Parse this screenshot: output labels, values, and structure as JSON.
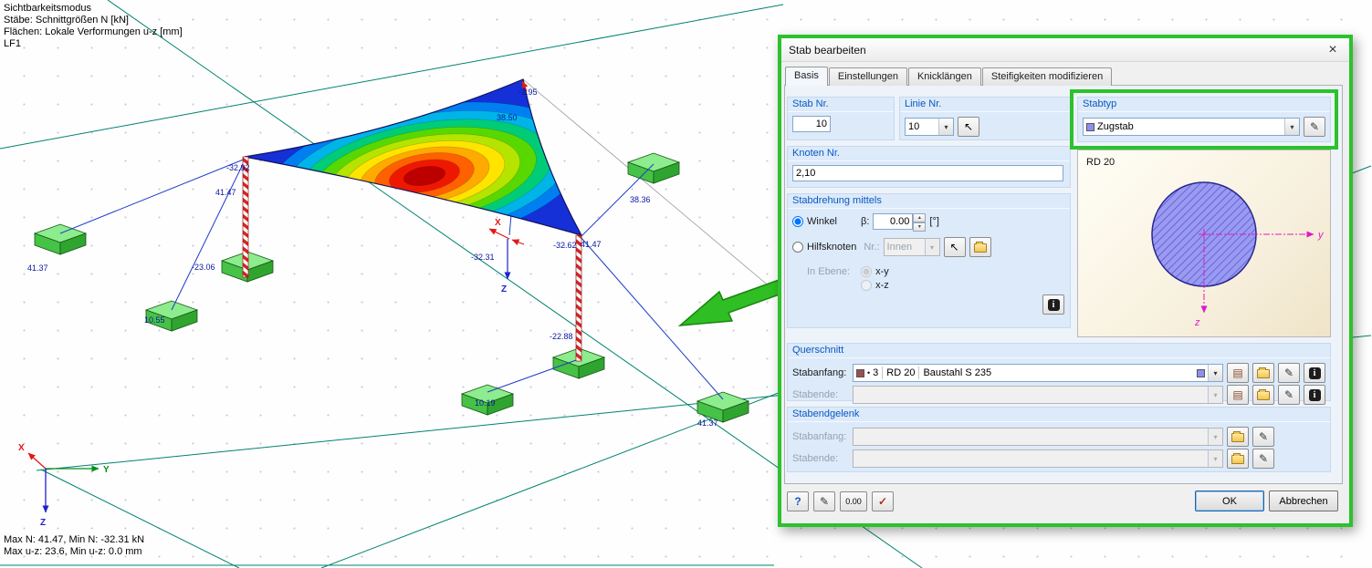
{
  "colors": {
    "highlight_green": "#2bc22b",
    "cable_blue": "#1c3cc8",
    "mast_red": "#d42424",
    "support_block_green": "#46c246",
    "contour_min_blue": "#1630d8",
    "contour_max_red": "#bc0000"
  },
  "icons": {
    "close": "×",
    "dropdown": "▾",
    "spin_up": "▴",
    "spin_down": "▾",
    "pick": "↖",
    "edit": "✎",
    "library": "▤",
    "info": "i",
    "help": "?",
    "check": "✓",
    "bullet": "•"
  },
  "viewport": {
    "info_lines": [
      "Sichtbarkeitsmodus",
      "Stäbe: Schnittgrößen N [kN]",
      "Flächen: Lokale Verformungen u-z [mm]",
      "LF1"
    ],
    "status_lines": [
      "Max N: 41.47, Min N: -32.31 kN",
      "Max u-z: 23.6, Min u-z: 0.0 mm"
    ],
    "axes": {
      "x": "X",
      "y": "Y",
      "z": "Z"
    },
    "force_labels": [
      "-2.95",
      "38.50",
      "-32.92",
      "41.47",
      "38.36",
      "41.37",
      "-23.06",
      "-32.31",
      "-32.62",
      "41.47",
      "10.55",
      "-22.88",
      "10.19",
      "41.37"
    ]
  },
  "dialog": {
    "title": "Stab bearbeiten",
    "tabs": [
      {
        "label": "Basis"
      },
      {
        "label": "Einstellungen"
      },
      {
        "label": "Knicklängen"
      },
      {
        "label": "Steifigkeiten modifizieren"
      }
    ],
    "groups": {
      "stab_nr": {
        "title": "Stab Nr.",
        "value": "10"
      },
      "linie_nr": {
        "title": "Linie Nr.",
        "value": "10"
      },
      "stabtyp": {
        "title": "Stabtyp",
        "value": "Zugstab"
      },
      "knoten_nr": {
        "title": "Knoten Nr.",
        "value": "2,10"
      },
      "stabdrehung": {
        "title": "Stabdrehung mittels",
        "winkel": "Winkel",
        "beta": "β:",
        "beta_value": "0.00",
        "deg_unit": "[°]",
        "hilfsknoten": "Hilfsknoten",
        "nr": "Nr.:",
        "nr_value": "Innen",
        "in_ebene": "In Ebene:",
        "xy": "x-y",
        "xz": "x-z"
      },
      "querschnitt": {
        "title": "Querschnitt",
        "stabanfang": "Stabanfang:",
        "stabende": "Stabende:",
        "num": "3",
        "name": "RD 20",
        "material": "Baustahl S 235"
      },
      "stabendgelenk": {
        "title": "Stabendgelenk",
        "stabanfang": "Stabanfang:",
        "stabende": "Stabende:"
      }
    },
    "preview": {
      "section_name": "RD 20",
      "axis_y": "y",
      "axis_z": "z"
    },
    "footer": {
      "ok": "OK",
      "cancel": "Abbrechen",
      "units_button": "0.00"
    }
  }
}
